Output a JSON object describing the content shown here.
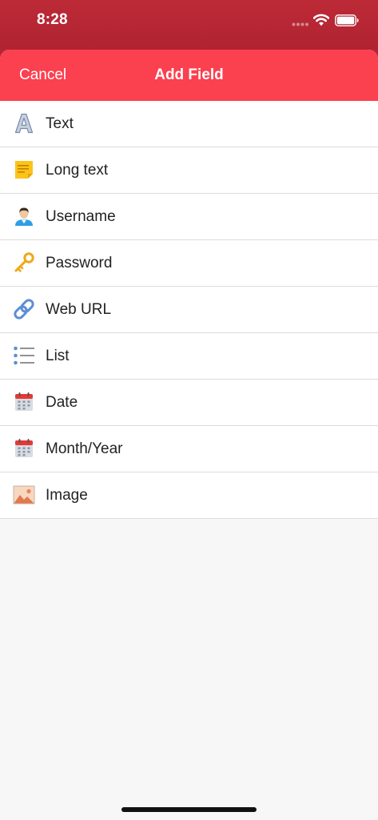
{
  "status_bar": {
    "time": "8:28",
    "icons": [
      "signal-icon",
      "wifi-icon",
      "battery-icon"
    ]
  },
  "nav": {
    "cancel_label": "Cancel",
    "title": "Add Field"
  },
  "fields": [
    {
      "label": "Text",
      "icon": "letter-a-icon"
    },
    {
      "label": "Long text",
      "icon": "sticky-note-icon"
    },
    {
      "label": "Username",
      "icon": "user-icon"
    },
    {
      "label": "Password",
      "icon": "key-icon"
    },
    {
      "label": "Web URL",
      "icon": "link-icon"
    },
    {
      "label": "List",
      "icon": "list-icon"
    },
    {
      "label": "Date",
      "icon": "calendar-icon"
    },
    {
      "label": "Month/Year",
      "icon": "calendar-icon"
    },
    {
      "label": "Image",
      "icon": "image-icon"
    }
  ],
  "colors": {
    "status_bar": "#b32633",
    "nav_bar": "#fb404f",
    "background": "#f7f7f7",
    "separator": "#dcdcdc",
    "text": "#222222"
  }
}
